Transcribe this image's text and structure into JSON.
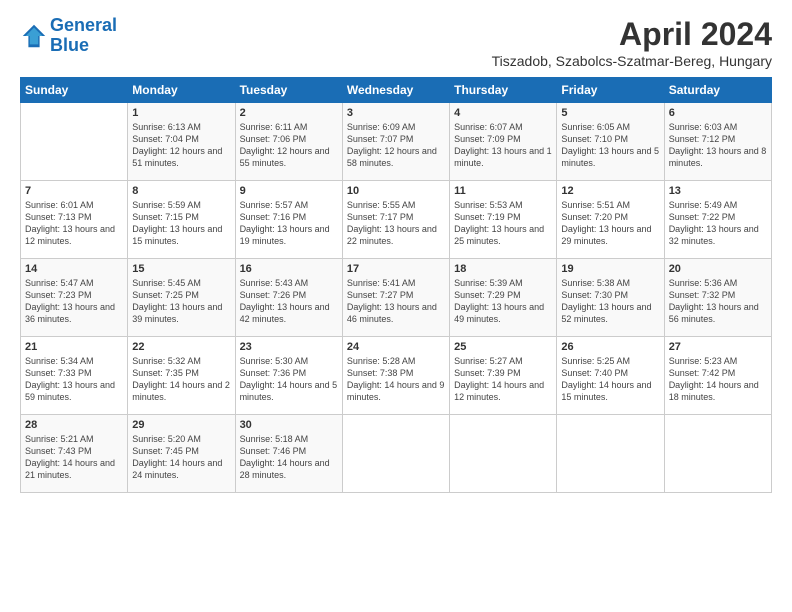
{
  "logo": {
    "line1": "General",
    "line2": "Blue"
  },
  "title": "April 2024",
  "location": "Tiszadob, Szabolcs-Szatmar-Bereg, Hungary",
  "days_of_week": [
    "Sunday",
    "Monday",
    "Tuesday",
    "Wednesday",
    "Thursday",
    "Friday",
    "Saturday"
  ],
  "weeks": [
    [
      {
        "day": "",
        "sunrise": "",
        "sunset": "",
        "daylight": ""
      },
      {
        "day": "1",
        "sunrise": "Sunrise: 6:13 AM",
        "sunset": "Sunset: 7:04 PM",
        "daylight": "Daylight: 12 hours and 51 minutes."
      },
      {
        "day": "2",
        "sunrise": "Sunrise: 6:11 AM",
        "sunset": "Sunset: 7:06 PM",
        "daylight": "Daylight: 12 hours and 55 minutes."
      },
      {
        "day": "3",
        "sunrise": "Sunrise: 6:09 AM",
        "sunset": "Sunset: 7:07 PM",
        "daylight": "Daylight: 12 hours and 58 minutes."
      },
      {
        "day": "4",
        "sunrise": "Sunrise: 6:07 AM",
        "sunset": "Sunset: 7:09 PM",
        "daylight": "Daylight: 13 hours and 1 minute."
      },
      {
        "day": "5",
        "sunrise": "Sunrise: 6:05 AM",
        "sunset": "Sunset: 7:10 PM",
        "daylight": "Daylight: 13 hours and 5 minutes."
      },
      {
        "day": "6",
        "sunrise": "Sunrise: 6:03 AM",
        "sunset": "Sunset: 7:12 PM",
        "daylight": "Daylight: 13 hours and 8 minutes."
      }
    ],
    [
      {
        "day": "7",
        "sunrise": "Sunrise: 6:01 AM",
        "sunset": "Sunset: 7:13 PM",
        "daylight": "Daylight: 13 hours and 12 minutes."
      },
      {
        "day": "8",
        "sunrise": "Sunrise: 5:59 AM",
        "sunset": "Sunset: 7:15 PM",
        "daylight": "Daylight: 13 hours and 15 minutes."
      },
      {
        "day": "9",
        "sunrise": "Sunrise: 5:57 AM",
        "sunset": "Sunset: 7:16 PM",
        "daylight": "Daylight: 13 hours and 19 minutes."
      },
      {
        "day": "10",
        "sunrise": "Sunrise: 5:55 AM",
        "sunset": "Sunset: 7:17 PM",
        "daylight": "Daylight: 13 hours and 22 minutes."
      },
      {
        "day": "11",
        "sunrise": "Sunrise: 5:53 AM",
        "sunset": "Sunset: 7:19 PM",
        "daylight": "Daylight: 13 hours and 25 minutes."
      },
      {
        "day": "12",
        "sunrise": "Sunrise: 5:51 AM",
        "sunset": "Sunset: 7:20 PM",
        "daylight": "Daylight: 13 hours and 29 minutes."
      },
      {
        "day": "13",
        "sunrise": "Sunrise: 5:49 AM",
        "sunset": "Sunset: 7:22 PM",
        "daylight": "Daylight: 13 hours and 32 minutes."
      }
    ],
    [
      {
        "day": "14",
        "sunrise": "Sunrise: 5:47 AM",
        "sunset": "Sunset: 7:23 PM",
        "daylight": "Daylight: 13 hours and 36 minutes."
      },
      {
        "day": "15",
        "sunrise": "Sunrise: 5:45 AM",
        "sunset": "Sunset: 7:25 PM",
        "daylight": "Daylight: 13 hours and 39 minutes."
      },
      {
        "day": "16",
        "sunrise": "Sunrise: 5:43 AM",
        "sunset": "Sunset: 7:26 PM",
        "daylight": "Daylight: 13 hours and 42 minutes."
      },
      {
        "day": "17",
        "sunrise": "Sunrise: 5:41 AM",
        "sunset": "Sunset: 7:27 PM",
        "daylight": "Daylight: 13 hours and 46 minutes."
      },
      {
        "day": "18",
        "sunrise": "Sunrise: 5:39 AM",
        "sunset": "Sunset: 7:29 PM",
        "daylight": "Daylight: 13 hours and 49 minutes."
      },
      {
        "day": "19",
        "sunrise": "Sunrise: 5:38 AM",
        "sunset": "Sunset: 7:30 PM",
        "daylight": "Daylight: 13 hours and 52 minutes."
      },
      {
        "day": "20",
        "sunrise": "Sunrise: 5:36 AM",
        "sunset": "Sunset: 7:32 PM",
        "daylight": "Daylight: 13 hours and 56 minutes."
      }
    ],
    [
      {
        "day": "21",
        "sunrise": "Sunrise: 5:34 AM",
        "sunset": "Sunset: 7:33 PM",
        "daylight": "Daylight: 13 hours and 59 minutes."
      },
      {
        "day": "22",
        "sunrise": "Sunrise: 5:32 AM",
        "sunset": "Sunset: 7:35 PM",
        "daylight": "Daylight: 14 hours and 2 minutes."
      },
      {
        "day": "23",
        "sunrise": "Sunrise: 5:30 AM",
        "sunset": "Sunset: 7:36 PM",
        "daylight": "Daylight: 14 hours and 5 minutes."
      },
      {
        "day": "24",
        "sunrise": "Sunrise: 5:28 AM",
        "sunset": "Sunset: 7:38 PM",
        "daylight": "Daylight: 14 hours and 9 minutes."
      },
      {
        "day": "25",
        "sunrise": "Sunrise: 5:27 AM",
        "sunset": "Sunset: 7:39 PM",
        "daylight": "Daylight: 14 hours and 12 minutes."
      },
      {
        "day": "26",
        "sunrise": "Sunrise: 5:25 AM",
        "sunset": "Sunset: 7:40 PM",
        "daylight": "Daylight: 14 hours and 15 minutes."
      },
      {
        "day": "27",
        "sunrise": "Sunrise: 5:23 AM",
        "sunset": "Sunset: 7:42 PM",
        "daylight": "Daylight: 14 hours and 18 minutes."
      }
    ],
    [
      {
        "day": "28",
        "sunrise": "Sunrise: 5:21 AM",
        "sunset": "Sunset: 7:43 PM",
        "daylight": "Daylight: 14 hours and 21 minutes."
      },
      {
        "day": "29",
        "sunrise": "Sunrise: 5:20 AM",
        "sunset": "Sunset: 7:45 PM",
        "daylight": "Daylight: 14 hours and 24 minutes."
      },
      {
        "day": "30",
        "sunrise": "Sunrise: 5:18 AM",
        "sunset": "Sunset: 7:46 PM",
        "daylight": "Daylight: 14 hours and 28 minutes."
      },
      {
        "day": "",
        "sunrise": "",
        "sunset": "",
        "daylight": ""
      },
      {
        "day": "",
        "sunrise": "",
        "sunset": "",
        "daylight": ""
      },
      {
        "day": "",
        "sunrise": "",
        "sunset": "",
        "daylight": ""
      },
      {
        "day": "",
        "sunrise": "",
        "sunset": "",
        "daylight": ""
      }
    ]
  ]
}
